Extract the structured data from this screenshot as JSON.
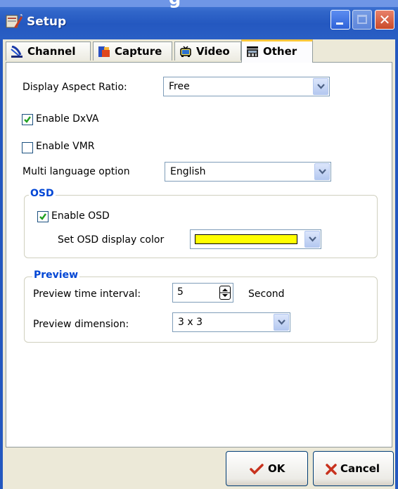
{
  "window": {
    "title": "Setup",
    "heading_fragment": "g"
  },
  "tabs": [
    {
      "label": "Channel"
    },
    {
      "label": "Capture"
    },
    {
      "label": "Video"
    },
    {
      "label": "Other"
    }
  ],
  "form": {
    "aspect_label": "Display Aspect Ratio:",
    "aspect_value": "Free",
    "dxva_label": "Enable DxVA",
    "vmr_label": "Enable VMR",
    "language_label": "Multi language option",
    "language_value": "English"
  },
  "osd": {
    "group_title": "OSD",
    "enable_label": "Enable OSD",
    "color_label": "Set OSD display color",
    "color_value": "#ffff00"
  },
  "preview": {
    "group_title": "Preview",
    "interval_label": "Preview time interval:",
    "interval_value": "5",
    "interval_unit": "Second",
    "dimension_label": "Preview dimension:",
    "dimension_value": "3 x 3"
  },
  "buttons": {
    "ok": "OK",
    "cancel": "Cancel"
  },
  "state": {
    "active_tab": "Other",
    "dxva_checked": true,
    "vmr_checked": false,
    "osd_checked": true
  }
}
